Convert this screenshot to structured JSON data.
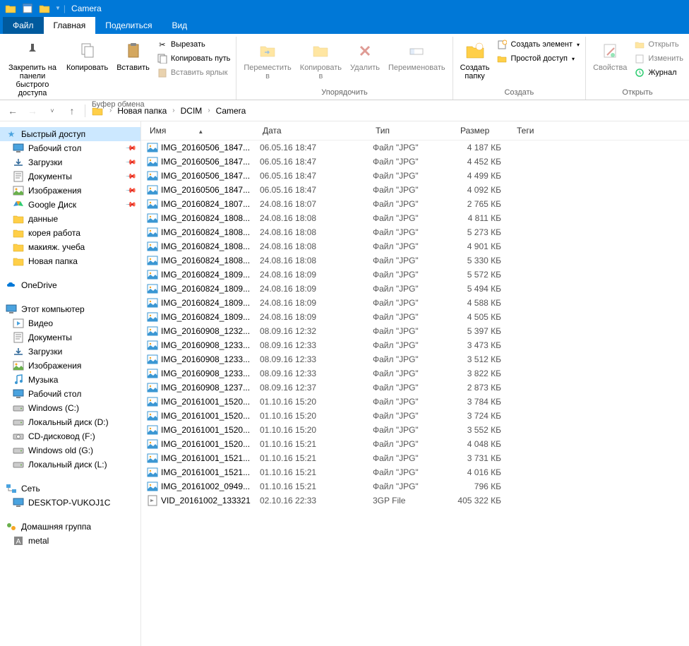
{
  "titlebar": {
    "title": "Camera"
  },
  "tabs": {
    "file": "Файл",
    "home": "Главная",
    "share": "Поделиться",
    "view": "Вид"
  },
  "ribbon": {
    "clipboard": {
      "label": "Буфер обмена",
      "pin": "Закрепить на панели\nбыстрого доступа",
      "copy": "Копировать",
      "paste": "Вставить",
      "cut": "Вырезать",
      "copypath": "Копировать путь",
      "pastelink": "Вставить ярлык"
    },
    "organize": {
      "label": "Упорядочить",
      "moveto": "Переместить\nв",
      "copyto": "Копировать\nв",
      "delete": "Удалить",
      "rename": "Переименовать"
    },
    "new": {
      "label": "Создать",
      "newfolder": "Создать\nпапку",
      "newitem": "Создать элемент",
      "easyaccess": "Простой доступ"
    },
    "open": {
      "label": "Открыть",
      "properties": "Свойства",
      "openbtn": "Открыть",
      "edit": "Изменить",
      "history": "Журнал"
    }
  },
  "breadcrumb": [
    "Новая папка",
    "DCIM",
    "Camera"
  ],
  "nav": {
    "quick": {
      "label": "Быстрый доступ",
      "items": [
        {
          "label": "Рабочий стол",
          "icon": "desktop",
          "pinned": true
        },
        {
          "label": "Загрузки",
          "icon": "downloads",
          "pinned": true
        },
        {
          "label": "Документы",
          "icon": "documents",
          "pinned": true
        },
        {
          "label": "Изображения",
          "icon": "pictures",
          "pinned": true
        },
        {
          "label": "Google Диск",
          "icon": "gdrive",
          "pinned": true
        },
        {
          "label": "данные",
          "icon": "folder",
          "pinned": false
        },
        {
          "label": "корея работа",
          "icon": "folder",
          "pinned": false
        },
        {
          "label": "макияж. учеба",
          "icon": "folder",
          "pinned": false
        },
        {
          "label": "Новая папка",
          "icon": "folder",
          "pinned": false
        }
      ]
    },
    "onedrive": {
      "label": "OneDrive"
    },
    "thispc": {
      "label": "Этот компьютер",
      "items": [
        {
          "label": "Видео",
          "icon": "videos"
        },
        {
          "label": "Документы",
          "icon": "documents"
        },
        {
          "label": "Загрузки",
          "icon": "downloads"
        },
        {
          "label": "Изображения",
          "icon": "pictures"
        },
        {
          "label": "Музыка",
          "icon": "music"
        },
        {
          "label": "Рабочий стол",
          "icon": "desktop"
        },
        {
          "label": "Windows (C:)",
          "icon": "drive"
        },
        {
          "label": "Локальный диск (D:)",
          "icon": "drive"
        },
        {
          "label": "CD-дисковод (F:)",
          "icon": "cd"
        },
        {
          "label": "Windows old (G:)",
          "icon": "drive"
        },
        {
          "label": "Локальный диск (L:)",
          "icon": "drive"
        }
      ]
    },
    "network": {
      "label": "Сеть",
      "items": [
        {
          "label": "DESKTOP-VUKOJ1C",
          "icon": "pc"
        }
      ]
    },
    "homegroup": {
      "label": "Домашняя группа",
      "items": [
        {
          "label": "metal",
          "icon": "user"
        }
      ]
    }
  },
  "columns": {
    "name": "Имя",
    "date": "Дата",
    "type": "Тип",
    "size": "Размер",
    "tags": "Теги"
  },
  "files": [
    {
      "name": "IMG_20160506_1847...",
      "date": "06.05.16 18:47",
      "type": "Файл \"JPG\"",
      "size": "4 187 КБ",
      "icon": "img"
    },
    {
      "name": "IMG_20160506_1847...",
      "date": "06.05.16 18:47",
      "type": "Файл \"JPG\"",
      "size": "4 452 КБ",
      "icon": "img"
    },
    {
      "name": "IMG_20160506_1847...",
      "date": "06.05.16 18:47",
      "type": "Файл \"JPG\"",
      "size": "4 499 КБ",
      "icon": "img"
    },
    {
      "name": "IMG_20160506_1847...",
      "date": "06.05.16 18:47",
      "type": "Файл \"JPG\"",
      "size": "4 092 КБ",
      "icon": "img"
    },
    {
      "name": "IMG_20160824_1807...",
      "date": "24.08.16 18:07",
      "type": "Файл \"JPG\"",
      "size": "2 765 КБ",
      "icon": "img"
    },
    {
      "name": "IMG_20160824_1808...",
      "date": "24.08.16 18:08",
      "type": "Файл \"JPG\"",
      "size": "4 811 КБ",
      "icon": "img"
    },
    {
      "name": "IMG_20160824_1808...",
      "date": "24.08.16 18:08",
      "type": "Файл \"JPG\"",
      "size": "5 273 КБ",
      "icon": "img"
    },
    {
      "name": "IMG_20160824_1808...",
      "date": "24.08.16 18:08",
      "type": "Файл \"JPG\"",
      "size": "4 901 КБ",
      "icon": "img"
    },
    {
      "name": "IMG_20160824_1808...",
      "date": "24.08.16 18:08",
      "type": "Файл \"JPG\"",
      "size": "5 330 КБ",
      "icon": "img"
    },
    {
      "name": "IMG_20160824_1809...",
      "date": "24.08.16 18:09",
      "type": "Файл \"JPG\"",
      "size": "5 572 КБ",
      "icon": "img"
    },
    {
      "name": "IMG_20160824_1809...",
      "date": "24.08.16 18:09",
      "type": "Файл \"JPG\"",
      "size": "5 494 КБ",
      "icon": "img"
    },
    {
      "name": "IMG_20160824_1809...",
      "date": "24.08.16 18:09",
      "type": "Файл \"JPG\"",
      "size": "4 588 КБ",
      "icon": "img"
    },
    {
      "name": "IMG_20160824_1809...",
      "date": "24.08.16 18:09",
      "type": "Файл \"JPG\"",
      "size": "4 505 КБ",
      "icon": "img"
    },
    {
      "name": "IMG_20160908_1232...",
      "date": "08.09.16 12:32",
      "type": "Файл \"JPG\"",
      "size": "5 397 КБ",
      "icon": "img"
    },
    {
      "name": "IMG_20160908_1233...",
      "date": "08.09.16 12:33",
      "type": "Файл \"JPG\"",
      "size": "3 473 КБ",
      "icon": "img"
    },
    {
      "name": "IMG_20160908_1233...",
      "date": "08.09.16 12:33",
      "type": "Файл \"JPG\"",
      "size": "3 512 КБ",
      "icon": "img"
    },
    {
      "name": "IMG_20160908_1233...",
      "date": "08.09.16 12:33",
      "type": "Файл \"JPG\"",
      "size": "3 822 КБ",
      "icon": "img"
    },
    {
      "name": "IMG_20160908_1237...",
      "date": "08.09.16 12:37",
      "type": "Файл \"JPG\"",
      "size": "2 873 КБ",
      "icon": "img"
    },
    {
      "name": "IMG_20161001_1520...",
      "date": "01.10.16 15:20",
      "type": "Файл \"JPG\"",
      "size": "3 784 КБ",
      "icon": "img"
    },
    {
      "name": "IMG_20161001_1520...",
      "date": "01.10.16 15:20",
      "type": "Файл \"JPG\"",
      "size": "3 724 КБ",
      "icon": "img"
    },
    {
      "name": "IMG_20161001_1520...",
      "date": "01.10.16 15:20",
      "type": "Файл \"JPG\"",
      "size": "3 552 КБ",
      "icon": "img"
    },
    {
      "name": "IMG_20161001_1520...",
      "date": "01.10.16 15:21",
      "type": "Файл \"JPG\"",
      "size": "4 048 КБ",
      "icon": "img"
    },
    {
      "name": "IMG_20161001_1521...",
      "date": "01.10.16 15:21",
      "type": "Файл \"JPG\"",
      "size": "3 731 КБ",
      "icon": "img"
    },
    {
      "name": "IMG_20161001_1521...",
      "date": "01.10.16 15:21",
      "type": "Файл \"JPG\"",
      "size": "4 016 КБ",
      "icon": "img"
    },
    {
      "name": "IMG_20161002_0949...",
      "date": "01.10.16 15:21",
      "type": "Файл \"JPG\"",
      "size": "796 КБ",
      "icon": "img"
    },
    {
      "name": "VID_20161002_133321",
      "date": "02.10.16 22:33",
      "type": "3GP File",
      "size": "405 322 КБ",
      "icon": "vid"
    }
  ]
}
